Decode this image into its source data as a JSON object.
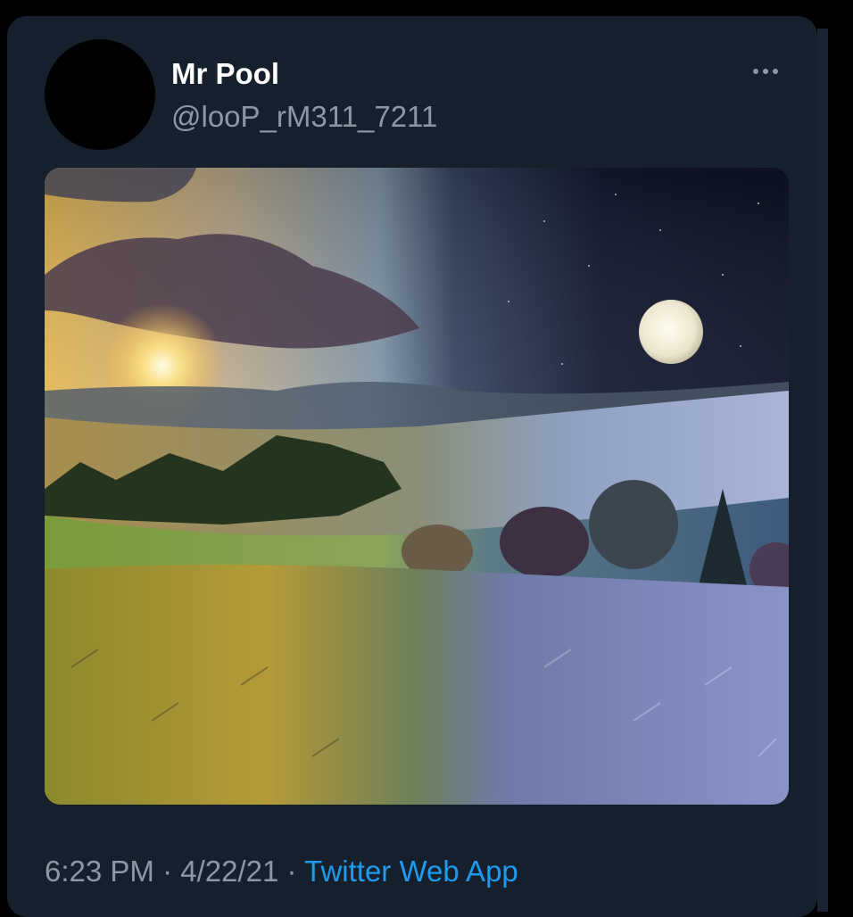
{
  "tweet": {
    "display_name": "Mr Pool",
    "handle": "@looP_rM311_7211",
    "time": "6:23 PM",
    "separator": "·",
    "date": "4/22/21",
    "source": "Twitter Web App"
  },
  "icons": {
    "more": "more-horizontal-icon"
  },
  "colors": {
    "background": "#000000",
    "card": "#16202c",
    "name": "#ffffff",
    "secondary_text": "#8b98a5",
    "link": "#1d9bf0"
  }
}
